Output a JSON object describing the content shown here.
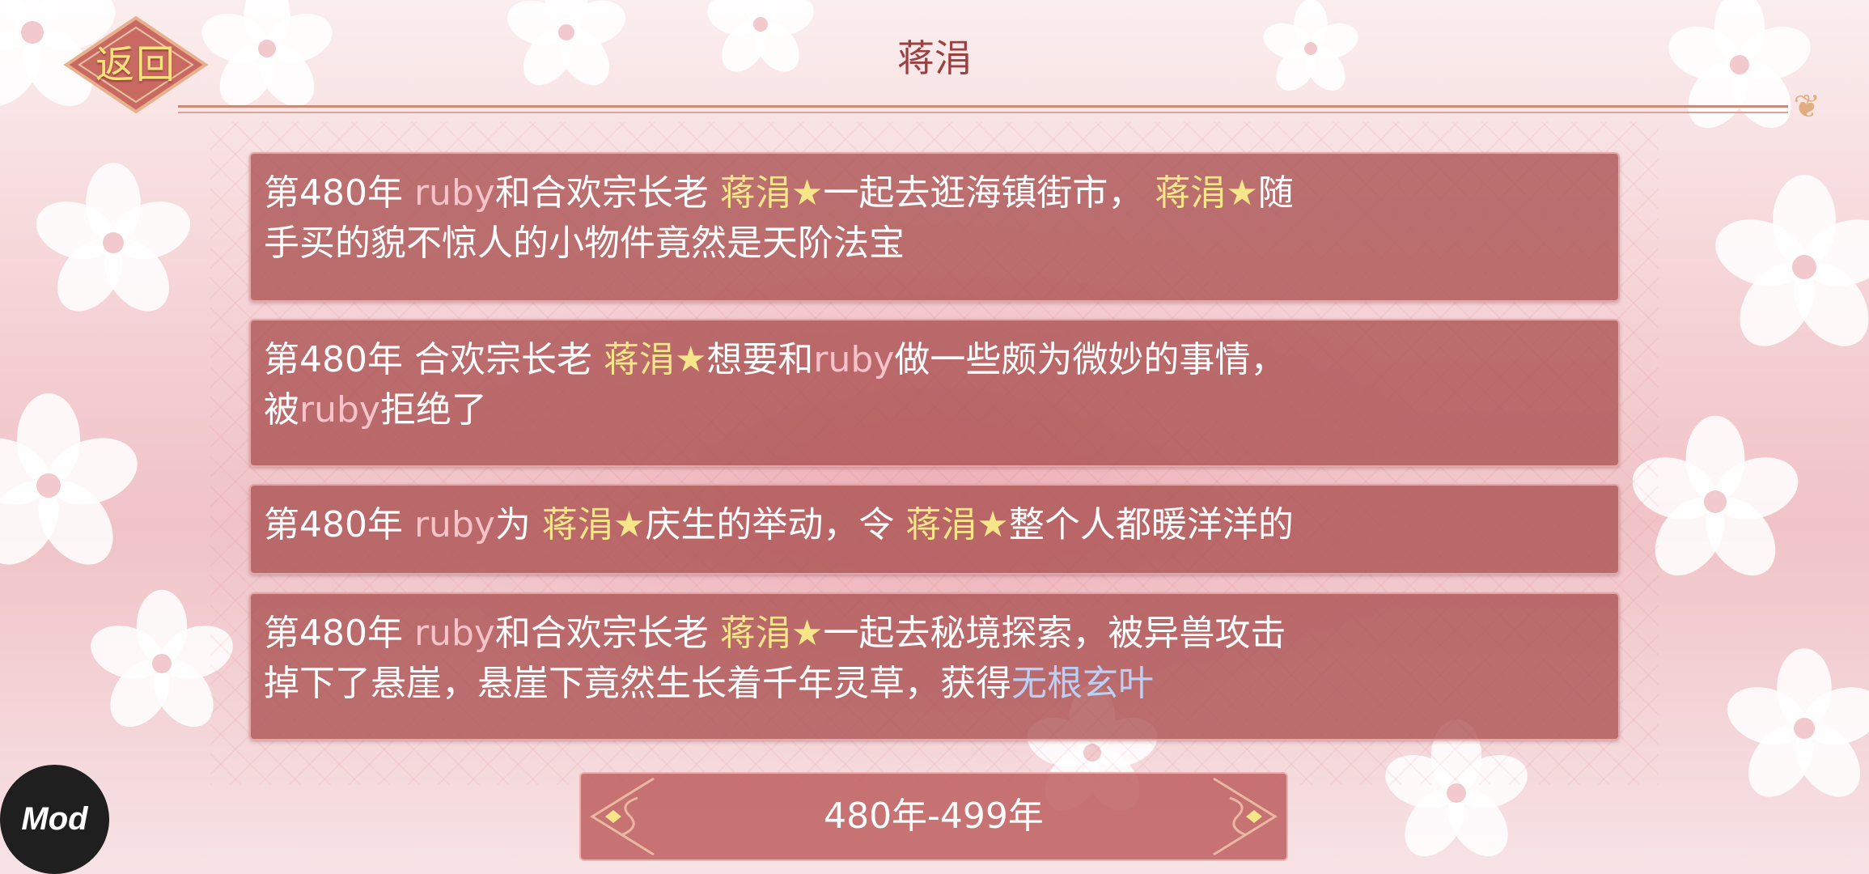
{
  "header": {
    "back_label": "返回",
    "title": "蒋涓"
  },
  "events": [
    {
      "line1": [
        {
          "t": "第480年 ",
          "c": "w"
        },
        {
          "t": "ruby",
          "c": "pink"
        },
        {
          "t": "和合欢宗长老 ",
          "c": "w"
        },
        {
          "t": "蒋涓★",
          "c": "gold"
        },
        {
          "t": "一起去逛海镇街市， ",
          "c": "w"
        },
        {
          "t": "蒋涓★",
          "c": "gold"
        },
        {
          "t": "随",
          "c": "w"
        }
      ],
      "line2": [
        {
          "t": "手买的貌不惊人的小物件竟然是天阶法宝",
          "c": "w"
        }
      ]
    },
    {
      "line1": [
        {
          "t": "第480年 合欢宗长老 ",
          "c": "w"
        },
        {
          "t": "蒋涓★",
          "c": "gold"
        },
        {
          "t": "想要和",
          "c": "w"
        },
        {
          "t": "ruby",
          "c": "pink"
        },
        {
          "t": "做一些颇为微妙的事情，",
          "c": "w"
        }
      ],
      "line2": [
        {
          "t": "被",
          "c": "w"
        },
        {
          "t": "ruby",
          "c": "pink"
        },
        {
          "t": "拒绝了",
          "c": "w"
        }
      ]
    },
    {
      "line1": [
        {
          "t": "第480年 ",
          "c": "w"
        },
        {
          "t": "ruby",
          "c": "pink"
        },
        {
          "t": "为 ",
          "c": "w"
        },
        {
          "t": "蒋涓★",
          "c": "gold"
        },
        {
          "t": "庆生的举动，令 ",
          "c": "w"
        },
        {
          "t": "蒋涓★",
          "c": "gold"
        },
        {
          "t": "整个人都暖洋洋的",
          "c": "w"
        }
      ],
      "line2": []
    },
    {
      "line1": [
        {
          "t": "第480年 ",
          "c": "w"
        },
        {
          "t": "ruby",
          "c": "pink"
        },
        {
          "t": "和合欢宗长老 ",
          "c": "w"
        },
        {
          "t": "蒋涓★",
          "c": "gold"
        },
        {
          "t": "一起去秘境探索，被异兽攻击",
          "c": "w"
        }
      ],
      "line2": [
        {
          "t": "掉下了悬崖，悬崖下竟然生长着千年灵草，获得",
          "c": "w"
        },
        {
          "t": "无根玄叶",
          "c": "blue"
        }
      ]
    }
  ],
  "period": {
    "label": "480年-499年"
  },
  "badge": {
    "label": "Mod"
  },
  "colors": {
    "card_bg": "#aa5050",
    "gold": "#f7e58a",
    "pink": "#f7c3c9",
    "blue": "#b9d0f7",
    "title": "#9c3f3f"
  },
  "icons": [
    "flower-icon",
    "back-diamond-icon",
    "prev-arrow-icon",
    "next-arrow-icon",
    "mod-badge-icon"
  ]
}
